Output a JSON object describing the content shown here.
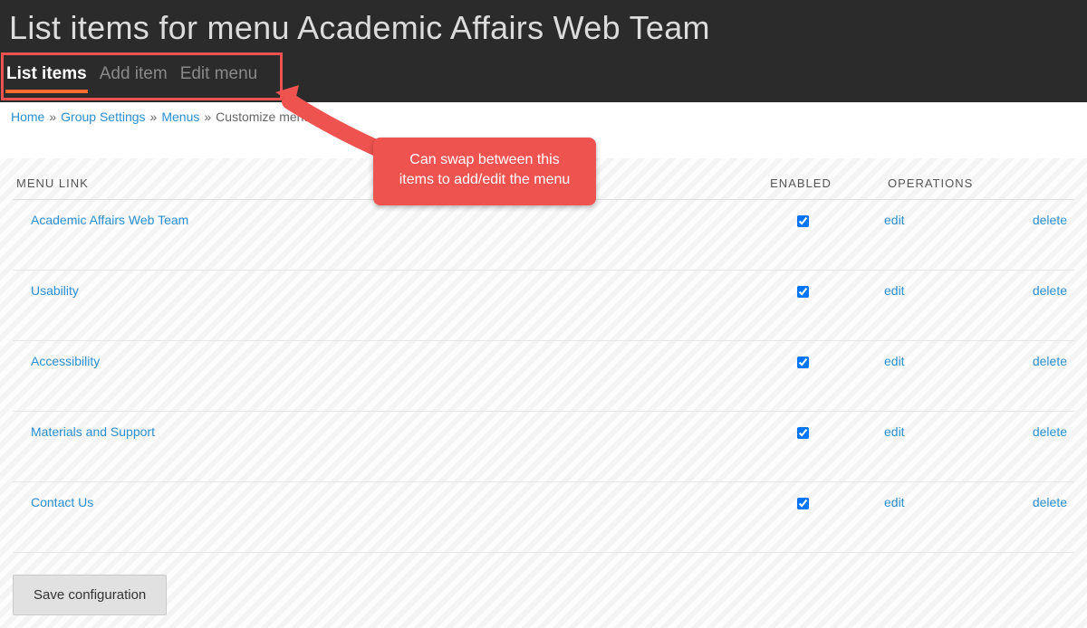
{
  "header": {
    "title": "List items for menu Academic Affairs Web Team",
    "tabs": [
      {
        "label": "List items",
        "active": true
      },
      {
        "label": "Add item",
        "active": false
      },
      {
        "label": "Edit menu",
        "active": false
      }
    ]
  },
  "breadcrumb": {
    "items": [
      {
        "label": "Home",
        "link": true
      },
      {
        "label": "Group Settings",
        "link": true
      },
      {
        "label": "Menus",
        "link": true
      },
      {
        "label": "Customize menu",
        "link": false
      }
    ],
    "separator": "»"
  },
  "callout": {
    "text": "Can swap between this items to add/edit the menu"
  },
  "table": {
    "headers": {
      "menu_link": "MENU LINK",
      "enabled": "ENABLED",
      "operations": "OPERATIONS"
    },
    "op_labels": {
      "edit": "edit",
      "delete": "delete"
    },
    "rows": [
      {
        "label": "Academic Affairs Web Team",
        "enabled": true
      },
      {
        "label": "Usability",
        "enabled": true
      },
      {
        "label": "Accessibility",
        "enabled": true
      },
      {
        "label": "Materials and Support",
        "enabled": true
      },
      {
        "label": "Contact Us",
        "enabled": true
      }
    ]
  },
  "buttons": {
    "save": "Save configuration"
  }
}
